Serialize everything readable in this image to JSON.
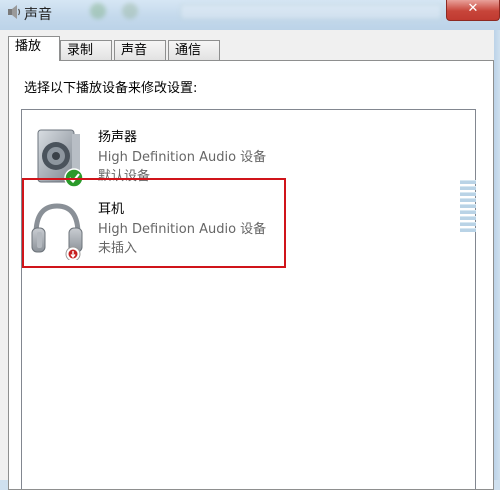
{
  "window": {
    "title": "声音",
    "icon": "speaker-icon"
  },
  "tabs": [
    {
      "label": "播放",
      "active": true
    },
    {
      "label": "录制",
      "active": false
    },
    {
      "label": "声音",
      "active": false
    },
    {
      "label": "通信",
      "active": false
    }
  ],
  "playback": {
    "instruction": "选择以下播放设备来修改设置:",
    "devices": [
      {
        "name": "扬声器",
        "description": "High Definition Audio 设备",
        "status": "默认设备",
        "icon": "speaker-device-icon",
        "badge": "default-check-icon"
      },
      {
        "name": "耳机",
        "description": "High Definition Audio 设备",
        "status": "未插入",
        "icon": "headphones-icon",
        "badge": "unplugged-icon"
      }
    ]
  },
  "colors": {
    "highlight": "#d0141a",
    "default_check": "#2a9a2a",
    "unplugged": "#c82020"
  }
}
